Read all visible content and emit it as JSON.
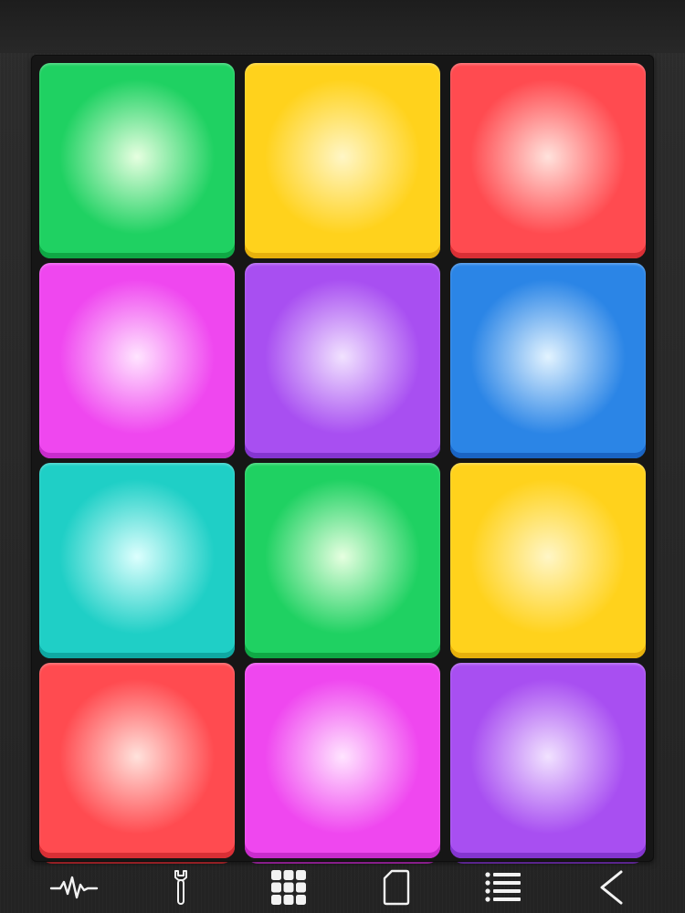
{
  "pads": [
    {
      "name": "pad-1-1",
      "color": "#1fd162",
      "glow": "#e6ffe0",
      "edge": "#0fa845"
    },
    {
      "name": "pad-1-2",
      "color": "#ffd21c",
      "glow": "#fff6c6",
      "edge": "#e6b00c"
    },
    {
      "name": "pad-1-3",
      "color": "#ff4b50",
      "glow": "#ffe2dc",
      "edge": "#d92f35"
    },
    {
      "name": "pad-2-1",
      "color": "#ef47ef",
      "glow": "#ffe4ff",
      "edge": "#c82ccc"
    },
    {
      "name": "pad-2-2",
      "color": "#a84ff1",
      "glow": "#f1e2ff",
      "edge": "#8435d0"
    },
    {
      "name": "pad-2-3",
      "color": "#2b85e6",
      "glow": "#e2f3ff",
      "edge": "#1a64c3"
    },
    {
      "name": "pad-3-1",
      "color": "#1fcfc6",
      "glow": "#dcfffe",
      "edge": "#0fa8a2"
    },
    {
      "name": "pad-3-2",
      "color": "#1fd162",
      "glow": "#e6ffe0",
      "edge": "#0fa845"
    },
    {
      "name": "pad-3-3",
      "color": "#ffd21c",
      "glow": "#fff6c6",
      "edge": "#e6b00c"
    },
    {
      "name": "pad-4-1",
      "color": "#ff4b50",
      "glow": "#ffe2dc",
      "edge": "#d92f35"
    },
    {
      "name": "pad-4-2",
      "color": "#ef47ef",
      "glow": "#ffe4ff",
      "edge": "#c82ccc"
    },
    {
      "name": "pad-4-3",
      "color": "#a84ff1",
      "glow": "#f1e2ff",
      "edge": "#8435d0"
    }
  ],
  "toolbar": {
    "icons": [
      "waveform-icon",
      "wrench-icon",
      "grid-icon",
      "page-icon",
      "list-icon",
      "back-chevron-icon"
    ],
    "icon_color": "#f2f2f2"
  },
  "colors": {
    "background": "#262626",
    "board": "#161616"
  }
}
